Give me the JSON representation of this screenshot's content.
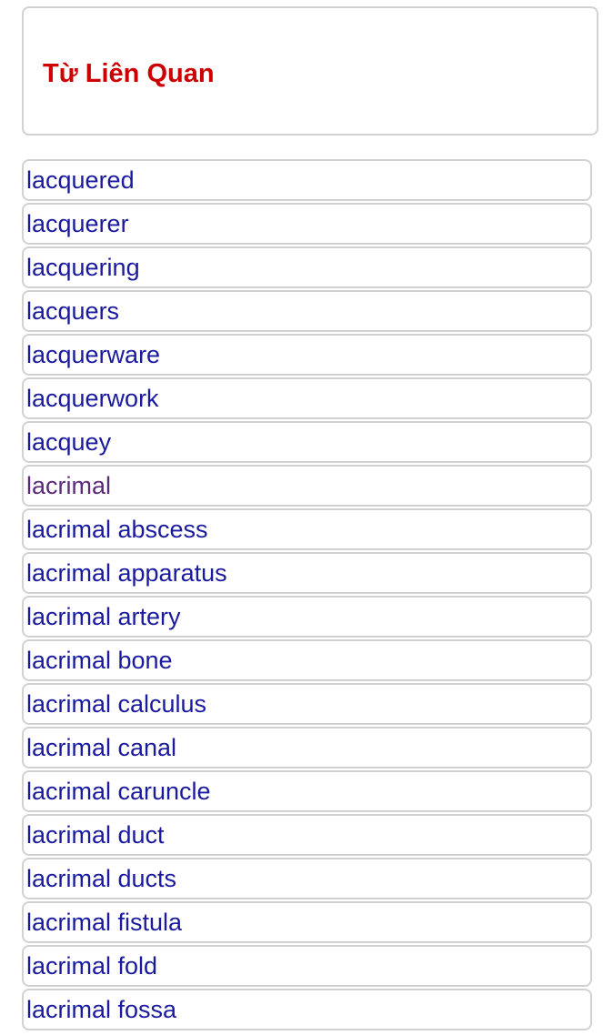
{
  "header": {
    "title": "Từ Liên Quan"
  },
  "colors": {
    "title": "#cc0000",
    "link": "#1a1a9e",
    "visited_link": "#5c2a7a",
    "border": "#d2d2d2"
  },
  "related_words": [
    {
      "label": "lacquered",
      "visited": false
    },
    {
      "label": "lacquerer",
      "visited": false
    },
    {
      "label": "lacquering",
      "visited": false
    },
    {
      "label": "lacquers",
      "visited": false
    },
    {
      "label": "lacquerware",
      "visited": false
    },
    {
      "label": "lacquerwork",
      "visited": false
    },
    {
      "label": "lacquey",
      "visited": false
    },
    {
      "label": "lacrimal",
      "visited": true
    },
    {
      "label": "lacrimal abscess",
      "visited": false
    },
    {
      "label": "lacrimal apparatus",
      "visited": false
    },
    {
      "label": "lacrimal artery",
      "visited": false
    },
    {
      "label": "lacrimal bone",
      "visited": false
    },
    {
      "label": "lacrimal calculus",
      "visited": false
    },
    {
      "label": "lacrimal canal",
      "visited": false
    },
    {
      "label": "lacrimal caruncle",
      "visited": false
    },
    {
      "label": "lacrimal duct",
      "visited": false
    },
    {
      "label": "lacrimal ducts",
      "visited": false
    },
    {
      "label": "lacrimal fistula",
      "visited": false
    },
    {
      "label": "lacrimal fold",
      "visited": false
    },
    {
      "label": "lacrimal fossa",
      "visited": false
    }
  ]
}
